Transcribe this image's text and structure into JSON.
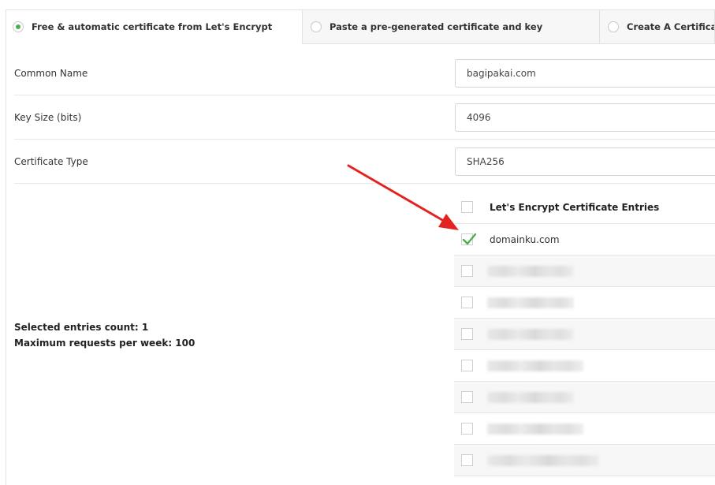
{
  "tabs": [
    {
      "label": "Free & automatic certificate from Let's Encrypt",
      "selected": true
    },
    {
      "label": "Paste a pre-generated certificate and key",
      "selected": false
    },
    {
      "label": "Create A Certificate Request",
      "selected": false
    }
  ],
  "form": {
    "common_name": {
      "label": "Common Name",
      "value": "bagipakai.com"
    },
    "key_size": {
      "label": "Key Size (bits)",
      "value": "4096"
    },
    "certificate_type": {
      "label": "Certificate Type",
      "value": "SHA256"
    }
  },
  "stats": {
    "selected_count": "Selected entries count: 1",
    "max_requests": "Maximum requests per week: 100"
  },
  "entries": {
    "header": "Let's Encrypt Certificate Entries",
    "first_domain": "domainku.com",
    "first_checked": true
  },
  "colors": {
    "accent_green": "#4caf50",
    "annotation_red": "#e52222"
  }
}
